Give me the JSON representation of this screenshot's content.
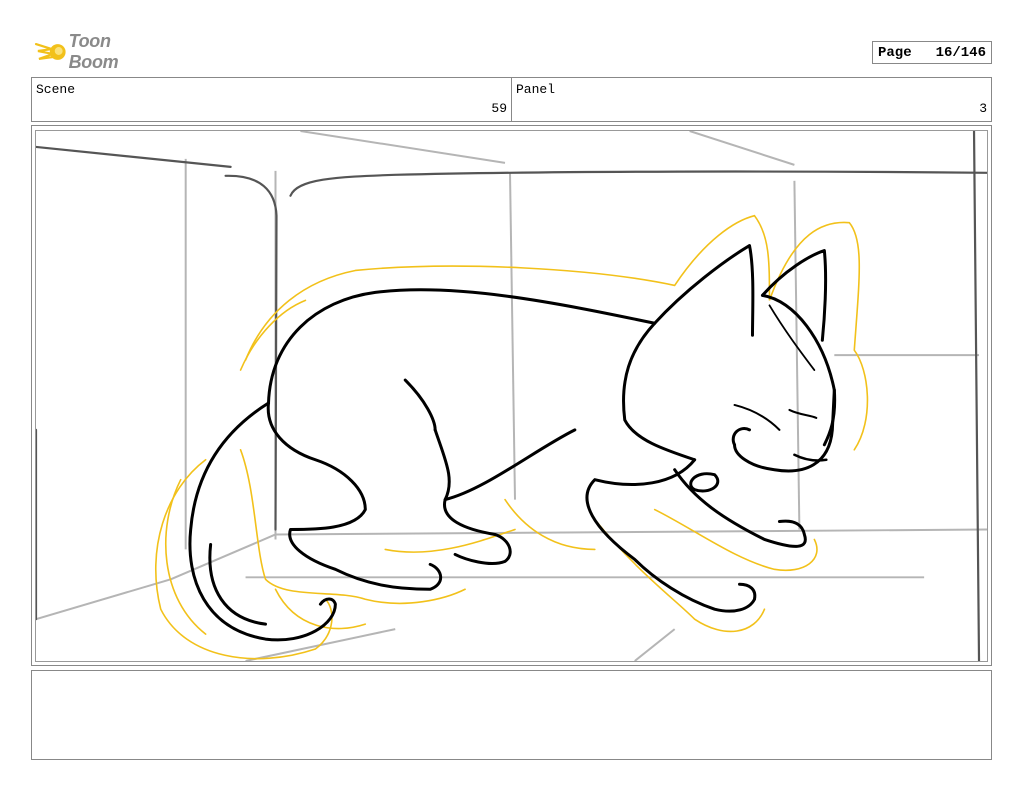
{
  "brand": {
    "name": "Toon Boom",
    "icon": "comet-logo-icon",
    "accent": "#f2c11a"
  },
  "page": {
    "label": "Page",
    "value": "16/146"
  },
  "scene": {
    "label": "Scene",
    "value": "59"
  },
  "panel": {
    "label": "Panel",
    "value": "3"
  },
  "sketch": {
    "line_color": "#000000",
    "glow_color": "#f2c11a",
    "background_lines": "#b5b5b5"
  }
}
